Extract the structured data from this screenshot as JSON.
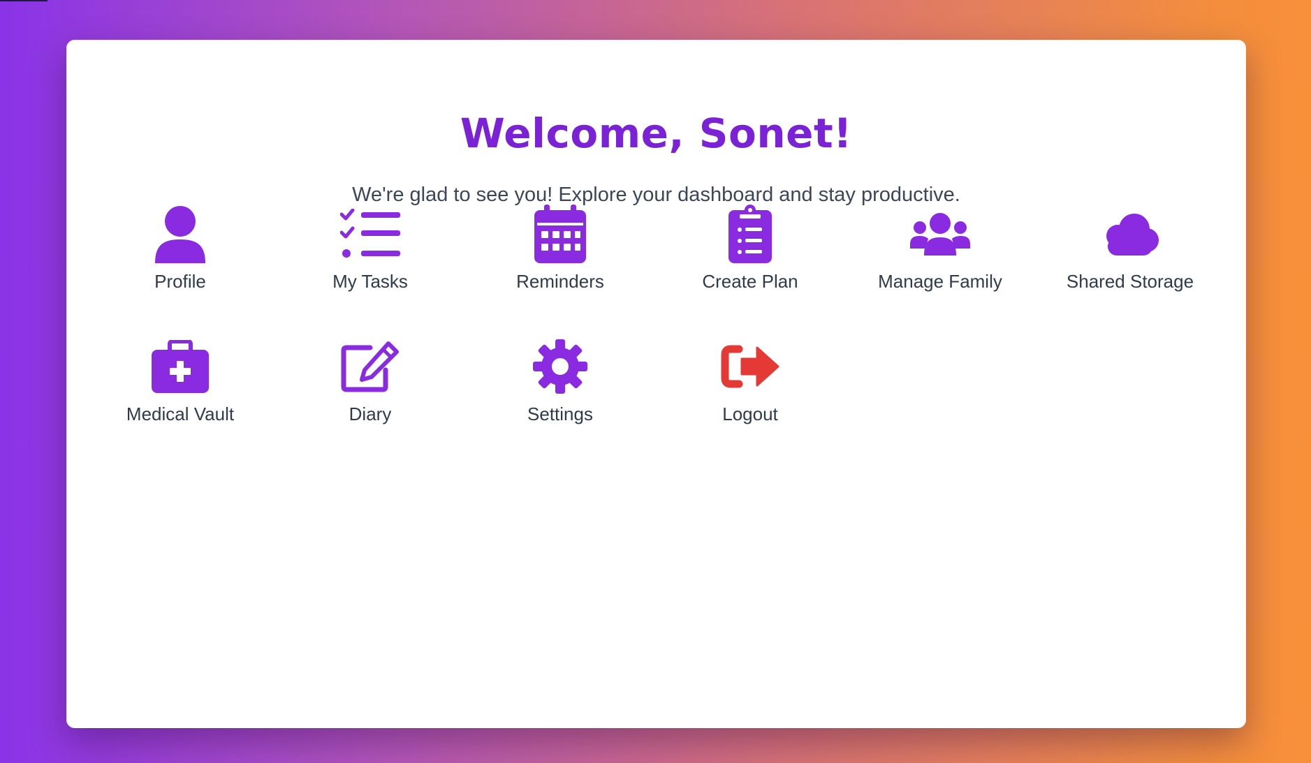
{
  "header": {
    "title": "Welcome, Sonet!",
    "subtitle": "We're glad to see you! Explore your dashboard and stay productive."
  },
  "colors": {
    "accent": "#8a2be2",
    "logout": "#e53935",
    "title": "#7b22d6"
  },
  "tiles": [
    {
      "label": "Profile",
      "icon": "user-icon"
    },
    {
      "label": "My Tasks",
      "icon": "task-list-icon"
    },
    {
      "label": "Reminders",
      "icon": "calendar-icon"
    },
    {
      "label": "Create Plan",
      "icon": "clipboard-list-icon"
    },
    {
      "label": "Manage Family",
      "icon": "users-icon"
    },
    {
      "label": "Shared Storage",
      "icon": "cloud-icon"
    },
    {
      "label": "Medical Vault",
      "icon": "medical-kit-icon"
    },
    {
      "label": "Diary",
      "icon": "edit-icon"
    },
    {
      "label": "Settings",
      "icon": "gear-icon"
    },
    {
      "label": "Logout",
      "icon": "logout-icon"
    }
  ]
}
